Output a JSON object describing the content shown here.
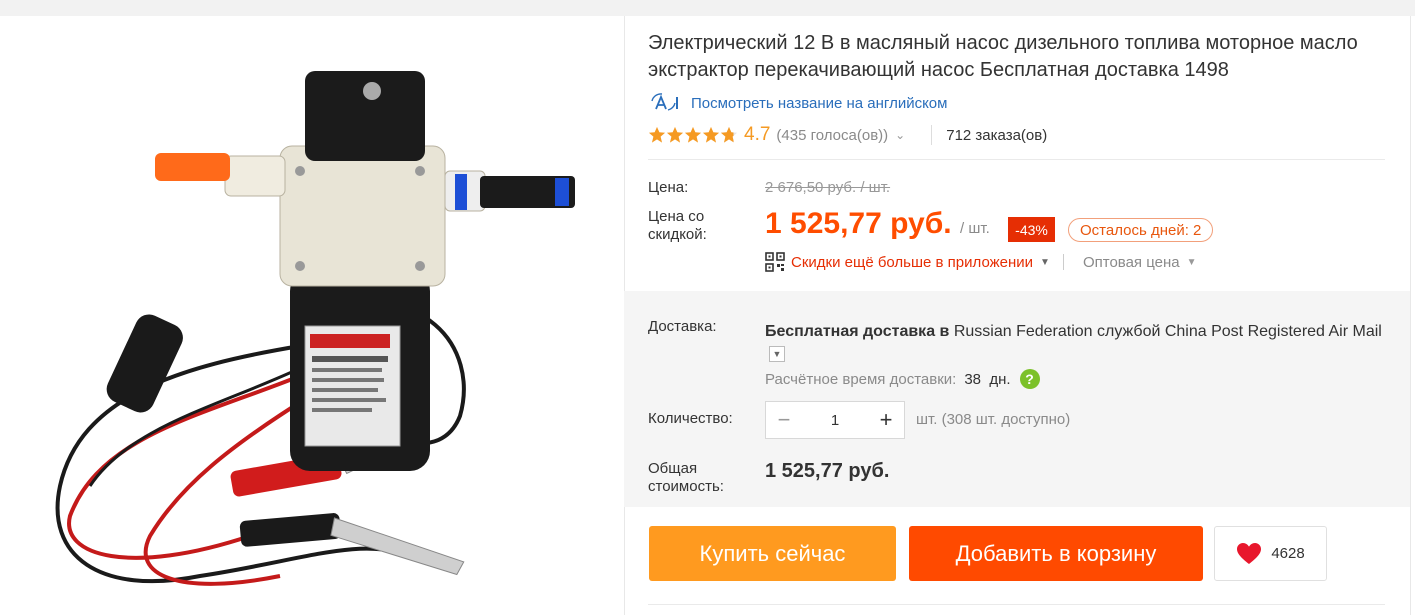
{
  "product": {
    "title": "Электрический 12 В в масляный насос дизельного топлива моторное масло экстрактор перекачивающий насос Бесплатная доставка 1498",
    "translate_link": "Посмотреть название на английском",
    "image_alt": "Electric 12V diesel fuel oil extractor pump"
  },
  "rating": {
    "value": "4.7",
    "votes": "(435 голоса(ов))",
    "orders": "712 заказа(ов)",
    "stars": 4.7
  },
  "price": {
    "price_label": "Цена:",
    "old_price": "2 676,50 руб. / шт.",
    "discount_label_line1": "Цена со",
    "discount_label_line2": "скидкой:",
    "new_price": "1 525,77 руб.",
    "unit": "/ шт.",
    "discount_badge": "-43%",
    "days_left": "Осталось дней: 2",
    "app_discount": "Скидки ещё больше в приложении",
    "wholesale": "Оптовая цена"
  },
  "shipping": {
    "label": "Доставка:",
    "text_bold": "Бесплатная доставка в",
    "text_rest": " Russian Federation службой China Post Registered Air Mail",
    "eta_label": "Расчётное время доставки:",
    "eta_value": "38  дн.",
    "help_glyph": "?"
  },
  "quantity": {
    "label": "Количество:",
    "value": "1",
    "minus": "−",
    "plus": "+",
    "available": "шт. (308 шт. доступно)"
  },
  "total": {
    "label_line1": "Общая",
    "label_line2": "стоимость:",
    "value": "1 525,77 руб."
  },
  "actions": {
    "buy_now": "Купить сейчас",
    "add_to_cart": "Добавить в корзину",
    "wishlist_count": "4628"
  },
  "colors": {
    "price": "#ff4d00",
    "buy_button": "#ff9a1f",
    "cart_button": "#ff4a00",
    "link": "#2a6ebb",
    "rating": "#f59a23"
  },
  "icons": [
    "ai-translate-icon",
    "star-icon",
    "chevron-down-icon",
    "qr-code-icon",
    "caret-down-icon",
    "help-icon",
    "heart-icon"
  ]
}
